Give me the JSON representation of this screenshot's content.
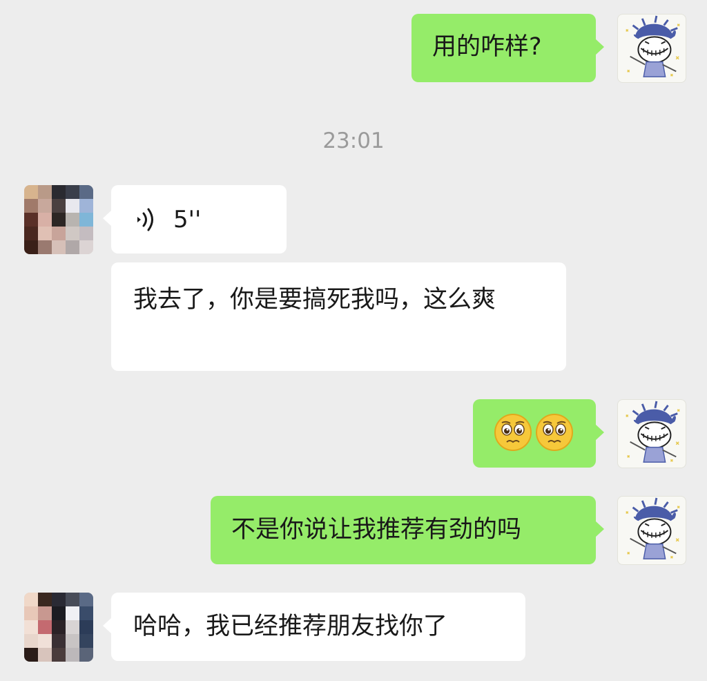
{
  "timestamp": "23:01",
  "messages": [
    {
      "sender": "me",
      "type": "text",
      "text": "用的咋样?"
    },
    {
      "sender": "them",
      "type": "voice",
      "duration": "5''",
      "icon": "voice-wave-icon"
    },
    {
      "sender": "them",
      "type": "text",
      "text": "我去了，你是要搞死我吗，这么爽"
    },
    {
      "sender": "me",
      "type": "emoji",
      "emojis": [
        "pleading-face-emoji",
        "pleading-face-emoji"
      ]
    },
    {
      "sender": "me",
      "type": "text",
      "text": "不是你说让我推荐有劲的吗"
    },
    {
      "sender": "them",
      "type": "text",
      "text": "哈哈，我已经推荐朋友找你了"
    }
  ],
  "colors": {
    "background": "#ededed",
    "my_bubble": "#95ec69",
    "their_bubble": "#ffffff",
    "timestamp": "#9a9a9a",
    "text": "#191919"
  }
}
